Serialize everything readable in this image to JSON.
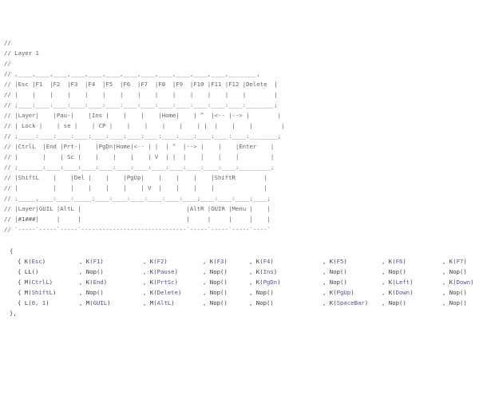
{
  "comment_lines": [
    "//",
    "// Layer 1",
    "//",
    "// ,____,____,____,____,____,____,____,____,____,____,____,____,________,",
    "// |Esc |F1  |F2  |F3  |F4  |F5  |F6  |F7  |F8  |F9  |F10 |F11 |F12 |Delete  |",
    "// |    |    |    |    |    |    |    |    |    |    |    |    |    |        |",
    "// ;____:____:____:____:____:____:____:____:____:____:____:____:____:________;",
    "// |Layer|    |Pau-|    |Ins |    |    |    |Home|    | ^  |<-- |--> |        |",
    "// | Lock |    | se |    | CP |    |    |    |    |    | |  |    |    |        |",
    "// ;_____:____:____:____:____:____:____:____:____:____:____:____:____:________;",
    "// |CtrlL  |End |Prt-|    |PgDn|Home|<-- | |  | ^  |--> |    |    |Enter    |",
    "// |       |    | Sc |    |    |    |    | V  | |  |    |    |    |         |",
    "// ;_______:____:____:____:____:____:____:____:____:____:____:____:_________;",
    "// |ShiftL    |    |Del |    |    |PgUp|    |    |    |    |ShiftR        |",
    "// |          |    |    |    |    |    | V  |    |    |    |              |",
    "// ;_____,____:____:_____;____:____:____:____:____:____;____:____:____;____;",
    "// |Layer|GUIL |AltL |                              |AltR |GUIR |Menu |    |",
    "// |#1###|     |     |                              |     |     |     |    |",
    "// `-----`-----`-----`------------------------------`-----`-----`-----`----`"
  ],
  "code": {
    "open": "{",
    "close": "},",
    "rows": [
      [
        {
          "pre": "{ ",
          "fn": "K",
          "arg": "Esc"
        },
        {
          "pre": ", ",
          "fn": "K",
          "arg": "F1"
        },
        {
          "pre": ", ",
          "fn": "K",
          "arg": "F2"
        },
        {
          "pre": ", ",
          "fn": "K",
          "arg": "F3"
        },
        {
          "pre": ", ",
          "fn": "K",
          "arg": "F4"
        },
        {
          "pre": ", ",
          "fn": "K",
          "arg": "F5"
        },
        {
          "pre": ", ",
          "fn": "K",
          "arg": "F6"
        },
        {
          "pre": ", ",
          "fn": "K",
          "arg": "F7"
        }
      ],
      [
        {
          "pre": "{ ",
          "fn": "LL",
          "arg": ""
        },
        {
          "pre": ", ",
          "fn": "Nop",
          "arg": ""
        },
        {
          "pre": ", ",
          "fn": "K",
          "arg": "Pause"
        },
        {
          "pre": ", ",
          "fn": "Nop",
          "arg": ""
        },
        {
          "pre": ", ",
          "fn": "K",
          "arg": "Ins"
        },
        {
          "pre": ", ",
          "fn": "Nop",
          "arg": ""
        },
        {
          "pre": ", ",
          "fn": "Nop",
          "arg": ""
        },
        {
          "pre": ", ",
          "fn": "Nop",
          "arg": ""
        }
      ],
      [
        {
          "pre": "{ ",
          "fn": "M",
          "arg": "CtrlL"
        },
        {
          "pre": ", ",
          "fn": "K",
          "arg": "End"
        },
        {
          "pre": ", ",
          "fn": "K",
          "arg": "PrtSc"
        },
        {
          "pre": ", ",
          "fn": "Nop",
          "arg": ""
        },
        {
          "pre": ", ",
          "fn": "K",
          "arg": "PgDn"
        },
        {
          "pre": ", ",
          "fn": "Nop",
          "arg": ""
        },
        {
          "pre": ", ",
          "fn": "K",
          "arg": "Left"
        },
        {
          "pre": ", ",
          "fn": "K",
          "arg": "Down"
        }
      ],
      [
        {
          "pre": "{ ",
          "fn": "M",
          "arg": "ShiftL"
        },
        {
          "pre": ", ",
          "fn": "Nop",
          "arg": ""
        },
        {
          "pre": ", ",
          "fn": "K",
          "arg": "Delete"
        },
        {
          "pre": ", ",
          "fn": "Nop",
          "arg": ""
        },
        {
          "pre": ", ",
          "fn": "Nop",
          "arg": ""
        },
        {
          "pre": ", ",
          "fn": "K",
          "arg": "PgUp"
        },
        {
          "pre": ", ",
          "fn": "K",
          "arg": "Down"
        },
        {
          "pre": ", ",
          "fn": "Nop",
          "arg": ""
        }
      ],
      [
        {
          "pre": "{ ",
          "fn": "L",
          "arg": "0, 1"
        },
        {
          "pre": ", ",
          "fn": "M",
          "arg": "GUIL"
        },
        {
          "pre": ", ",
          "fn": "M",
          "arg": "AltL"
        },
        {
          "pre": ", ",
          "fn": "Nop",
          "arg": ""
        },
        {
          "pre": ", ",
          "fn": "Nop",
          "arg": ""
        },
        {
          "pre": ", ",
          "fn": "K",
          "arg": "SpaceBar"
        },
        {
          "pre": ", ",
          "fn": "Nop",
          "arg": ""
        },
        {
          "pre": ", ",
          "fn": "Nop",
          "arg": ""
        }
      ]
    ]
  },
  "colors": {
    "background": "#ffffff",
    "comment": "#5f6368",
    "text": "#2b2b2b",
    "argument": "#5b4a9e"
  }
}
